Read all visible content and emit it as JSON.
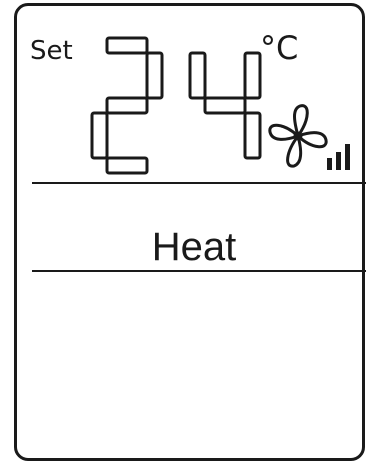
{
  "display": {
    "set_label": "Set",
    "temperature_digit_1": "2",
    "temperature_digit_2": "4",
    "temperature_unit": "°C",
    "fan_icon": "fan-icon",
    "fan_speed_level": 3,
    "fan_speed_max": 3,
    "mode": "Heat"
  },
  "colors": {
    "segment": "#1a1a1a",
    "background": "#ffffff"
  }
}
